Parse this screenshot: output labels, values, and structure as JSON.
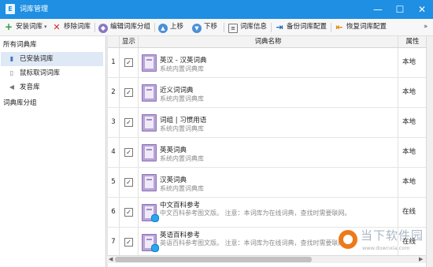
{
  "window": {
    "title": "词库管理",
    "icon_glyph": "E",
    "buttons": {
      "minimize": "—",
      "maximize": "☐",
      "close": "✕"
    }
  },
  "toolbar": {
    "install_label": "安装词库",
    "install_dropdown": "▾",
    "remove_label": "移除词库",
    "edit_group_label": "编辑词库分组",
    "move_up_label": "上移",
    "move_down_label": "下移",
    "info_label": "词库信息",
    "backup_label": "备份词库配置",
    "restore_label": "恢复词库配置",
    "overflow": "»"
  },
  "sidebar": {
    "title": "所有词典库",
    "items": [
      {
        "label": "已安装词库",
        "icon": "book-stack-icon",
        "selected": true
      },
      {
        "label": "鼠标取词词库",
        "icon": "mouse-icon",
        "selected": false
      },
      {
        "label": "发音库",
        "icon": "speaker-icon",
        "selected": false
      }
    ],
    "group_label": "词典库分组"
  },
  "table": {
    "headers": {
      "show": "显示",
      "name": "词典名称",
      "attr": "属性"
    },
    "rows": [
      {
        "idx": "1",
        "checked": "✓",
        "title": "英汉 - 汉英词典",
        "sub": "系统内置词典库",
        "attr": "本地"
      },
      {
        "idx": "2",
        "checked": "✓",
        "title": "近义词词典",
        "sub": "系统内置词典库",
        "attr": "本地"
      },
      {
        "idx": "3",
        "checked": "✓",
        "title": "词组 | 习惯用语",
        "sub": "系统内置词典库",
        "attr": "本地"
      },
      {
        "idx": "4",
        "checked": "✓",
        "title": "英英词典",
        "sub": "系统内置词典库",
        "attr": "本地"
      },
      {
        "idx": "5",
        "checked": "✓",
        "title": "汉英词典",
        "sub": "系统内置词典库",
        "attr": "本地"
      },
      {
        "idx": "6",
        "checked": "✓",
        "title": "中文百科参考",
        "sub": "中文百科参考图文版。 注意：本词库为在线词典，查找时需要联网。",
        "attr": "在线"
      },
      {
        "idx": "7",
        "checked": "✓",
        "title": "英语百科参考",
        "sub": "英语百科参考图文版。 注意：本词库为在线词典，查找时需要联网。",
        "attr": "在线"
      }
    ]
  },
  "watermark": {
    "text": "当下软件园",
    "url": "www.downxia.com"
  },
  "colors": {
    "titlebar": "#1e8fe3",
    "selected": "#dfe8f5",
    "book": "#b9a3d7"
  }
}
